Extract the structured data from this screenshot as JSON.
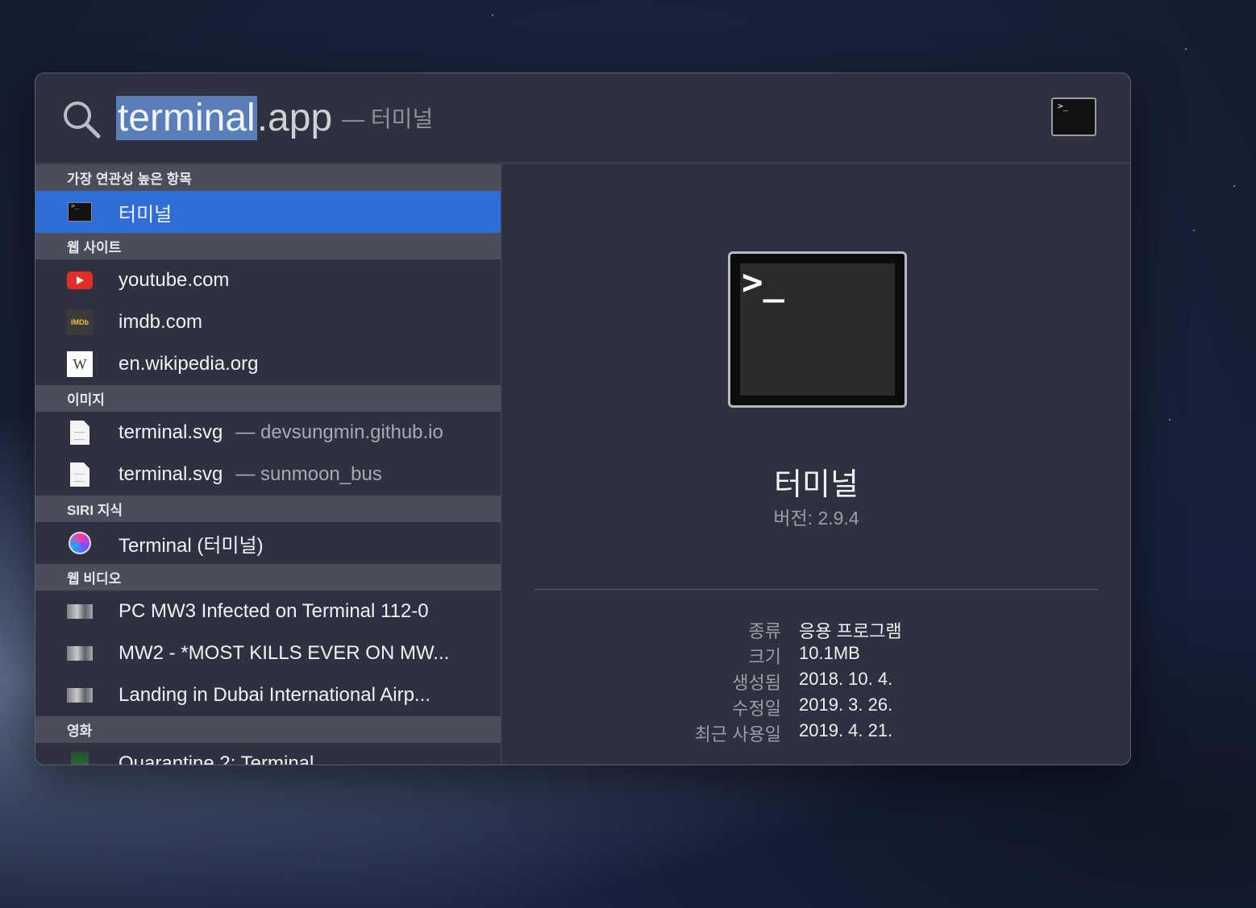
{
  "search": {
    "query_selected": "terminal",
    "query_rest": ".app",
    "query_hint": "— 터미널"
  },
  "results": {
    "sections": [
      {
        "header": "가장 연관성 높은 항목",
        "items": [
          {
            "label": "터미널",
            "sub": "",
            "icon": "terminal-app-icon",
            "selected": true
          }
        ]
      },
      {
        "header": "웹 사이트",
        "items": [
          {
            "label": "youtube.com",
            "sub": "",
            "icon": "youtube-icon"
          },
          {
            "label": "imdb.com",
            "sub": "",
            "icon": "imdb-icon"
          },
          {
            "label": "en.wikipedia.org",
            "sub": "",
            "icon": "wikipedia-icon"
          }
        ]
      },
      {
        "header": "이미지",
        "items": [
          {
            "label": "terminal.svg",
            "sub": "— devsungmin.github.io",
            "icon": "file-icon"
          },
          {
            "label": "terminal.svg",
            "sub": "— sunmoon_bus",
            "icon": "file-icon"
          }
        ]
      },
      {
        "header": "SIRI 지식",
        "items": [
          {
            "label": "Terminal (터미널)",
            "sub": "",
            "icon": "siri-icon"
          }
        ]
      },
      {
        "header": "웹 비디오",
        "items": [
          {
            "label": "PC MW3 Infected on Terminal 112-0",
            "sub": "",
            "icon": "video-thumbnail-icon"
          },
          {
            "label": "MW2 - *MOST KILLS EVER ON MW...",
            "sub": "",
            "icon": "video-thumbnail-icon"
          },
          {
            "label": "Landing in Dubai International Airp...",
            "sub": "",
            "icon": "video-thumbnail-icon"
          }
        ]
      },
      {
        "header": "영화",
        "items": [
          {
            "label": "Quarantine 2: Terminal",
            "sub": "",
            "icon": "movie-poster-icon"
          }
        ]
      }
    ]
  },
  "icons": {
    "imdb_text": "IMDb",
    "wiki_text": "W",
    "prompt": ">_"
  },
  "detail": {
    "name": "터미널",
    "version": "버전: 2.9.4",
    "info": [
      {
        "key": "종류",
        "value": "응용 프로그램"
      },
      {
        "key": "크기",
        "value": "10.1MB"
      },
      {
        "key": "생성됨",
        "value": "2018. 10. 4."
      },
      {
        "key": "수정일",
        "value": "2019. 3. 26."
      },
      {
        "key": "최근 사용일",
        "value": "2019. 4. 21."
      }
    ]
  },
  "colors": {
    "selection": "#2f6ed6",
    "panel": "#2d3140",
    "section_header": "#4a4e5b"
  }
}
